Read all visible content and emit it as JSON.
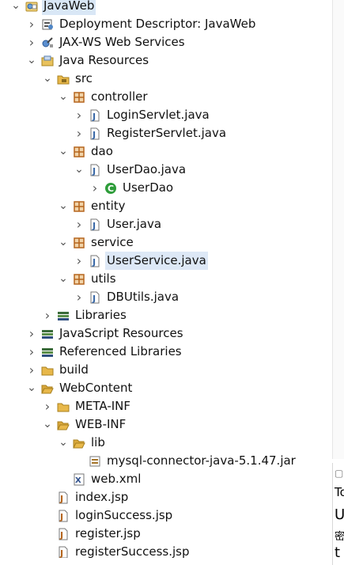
{
  "tree": [
    {
      "label": "JavaWeb",
      "depth": 0,
      "expand": "open",
      "icon": "project",
      "top": true
    },
    {
      "label": "Deployment Descriptor: JavaWeb",
      "depth": 1,
      "expand": "closed",
      "icon": "descriptor"
    },
    {
      "label": "JAX-WS Web Services",
      "depth": 1,
      "expand": "closed",
      "icon": "webservice"
    },
    {
      "label": "Java Resources",
      "depth": 1,
      "expand": "open",
      "icon": "java-resources"
    },
    {
      "label": "src",
      "depth": 2,
      "expand": "open",
      "icon": "source-folder"
    },
    {
      "label": "controller",
      "depth": 3,
      "expand": "open",
      "icon": "package"
    },
    {
      "label": "LoginServlet.java",
      "depth": 4,
      "expand": "closed",
      "icon": "java-file"
    },
    {
      "label": "RegisterServlet.java",
      "depth": 4,
      "expand": "closed",
      "icon": "java-file"
    },
    {
      "label": "dao",
      "depth": 3,
      "expand": "open",
      "icon": "package"
    },
    {
      "label": "UserDao.java",
      "depth": 4,
      "expand": "open",
      "icon": "java-file"
    },
    {
      "label": "UserDao",
      "depth": 5,
      "expand": "closed",
      "icon": "class"
    },
    {
      "label": "entity",
      "depth": 3,
      "expand": "open",
      "icon": "package"
    },
    {
      "label": "User.java",
      "depth": 4,
      "expand": "closed",
      "icon": "java-file"
    },
    {
      "label": "service",
      "depth": 3,
      "expand": "open",
      "icon": "package"
    },
    {
      "label": "UserService.java",
      "depth": 4,
      "expand": "closed",
      "icon": "java-file",
      "selected": true
    },
    {
      "label": "utils",
      "depth": 3,
      "expand": "open",
      "icon": "package"
    },
    {
      "label": "DBUtils.java",
      "depth": 4,
      "expand": "closed",
      "icon": "java-file"
    },
    {
      "label": "Libraries",
      "depth": 2,
      "expand": "closed",
      "icon": "libraries"
    },
    {
      "label": "JavaScript Resources",
      "depth": 1,
      "expand": "closed",
      "icon": "libraries"
    },
    {
      "label": "Referenced Libraries",
      "depth": 1,
      "expand": "closed",
      "icon": "libraries"
    },
    {
      "label": "build",
      "depth": 1,
      "expand": "closed",
      "icon": "folder"
    },
    {
      "label": "WebContent",
      "depth": 1,
      "expand": "open",
      "icon": "open-folder"
    },
    {
      "label": "META-INF",
      "depth": 2,
      "expand": "closed",
      "icon": "folder"
    },
    {
      "label": "WEB-INF",
      "depth": 2,
      "expand": "open",
      "icon": "open-folder"
    },
    {
      "label": "lib",
      "depth": 3,
      "expand": "open",
      "icon": "open-folder"
    },
    {
      "label": "mysql-connector-java-5.1.47.jar",
      "depth": 4,
      "expand": "none",
      "icon": "jar"
    },
    {
      "label": "web.xml",
      "depth": 3,
      "expand": "none",
      "icon": "xml"
    },
    {
      "label": "index.jsp",
      "depth": 2,
      "expand": "none",
      "icon": "jsp"
    },
    {
      "label": "loginSuccess.jsp",
      "depth": 2,
      "expand": "none",
      "icon": "jsp"
    },
    {
      "label": "register.jsp",
      "depth": 2,
      "expand": "none",
      "icon": "jsp"
    },
    {
      "label": "registerSuccess.jsp",
      "depth": 2,
      "expand": "none",
      "icon": "jsp"
    }
  ],
  "side_panel": {
    "lines": [
      "To",
      "U",
      "密",
      "t"
    ]
  },
  "colors": {
    "selection": "#dde8f6",
    "package": "#b5651d",
    "folder": "#e8b84a",
    "java": "#3b6aa8",
    "class": "#2e9d3a"
  }
}
